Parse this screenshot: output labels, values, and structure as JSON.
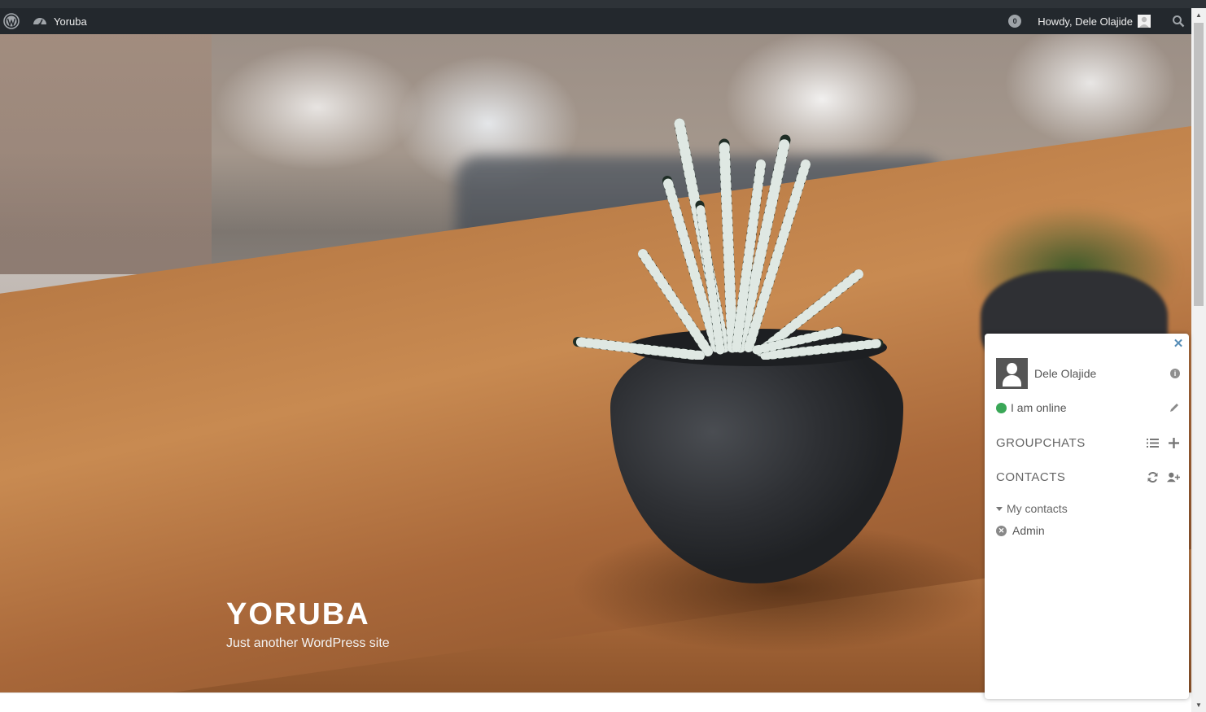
{
  "adminbar": {
    "site_name": "Yoruba",
    "comments_count": "0",
    "howdy": "Howdy, Dele Olajide"
  },
  "hero": {
    "site_title": "YORUBA",
    "site_description": "Just another WordPress site"
  },
  "chat": {
    "profile_name": "Dele Olajide",
    "status": "I am online",
    "groupchats_heading": "GROUPCHATS",
    "contacts_heading": "CONTACTS",
    "group_name": "My contacts",
    "contacts": [
      "Admin"
    ],
    "close_symbol": "✕",
    "info_symbol": "i",
    "offline_symbol": "✕"
  },
  "colors": {
    "adminbar_bg": "#23282d",
    "status_online": "#3aa757",
    "close_blue": "#578eb7"
  },
  "icons": [
    "wordpress-icon",
    "dashboard-icon",
    "comments-icon",
    "user-avatar-icon",
    "search-icon",
    "close-icon",
    "info-icon",
    "pencil-icon",
    "list-icon",
    "plus-icon",
    "refresh-icon",
    "add-user-icon",
    "caret-down-icon",
    "offline-status-icon"
  ]
}
